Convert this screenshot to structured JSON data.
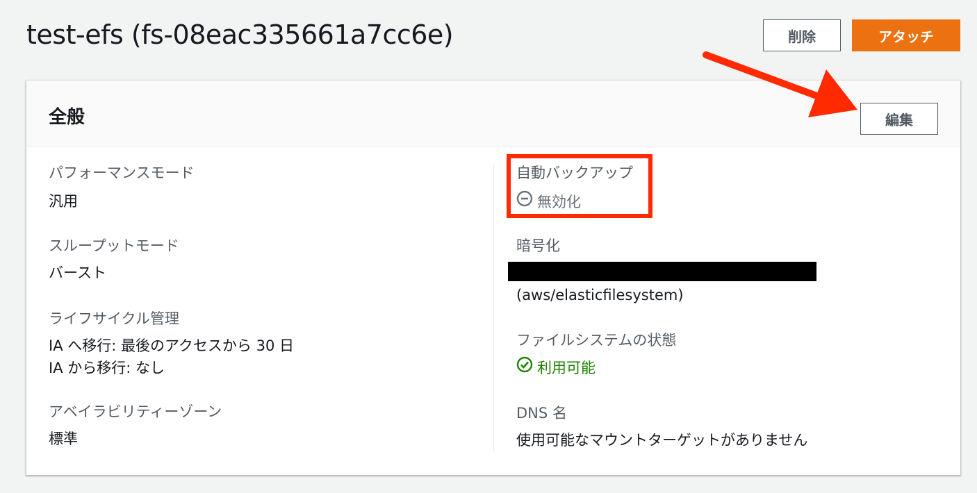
{
  "header": {
    "title": "test-efs (fs-08eac335661a7cc6e)",
    "delete_label": "削除",
    "attach_label": "アタッチ"
  },
  "panel": {
    "title": "全般",
    "edit_label": "編集"
  },
  "left_fields": {
    "performance_mode": {
      "label": "パフォーマンスモード",
      "value": "汎用"
    },
    "throughput_mode": {
      "label": "スループットモード",
      "value": "バースト"
    },
    "lifecycle": {
      "label": "ライフサイクル管理",
      "value_line1": "IA へ移行: 最後のアクセスから 30 日",
      "value_line2": "IA から移行: なし"
    },
    "availability_zone": {
      "label": "アベイラビリティーゾーン",
      "value": "標準"
    }
  },
  "right_fields": {
    "auto_backup": {
      "label": "自動バックアップ",
      "value": "無効化",
      "icon": "minus-circle-icon"
    },
    "encryption": {
      "label": "暗号化",
      "value": "(aws/elasticfilesystem)"
    },
    "fs_state": {
      "label": "ファイルシステムの状態",
      "value": "利用可能",
      "icon": "check-circle-icon"
    },
    "dns_name": {
      "label": "DNS 名",
      "value": "使用可能なマウントターゲットがありません"
    }
  },
  "colors": {
    "accent": "#ec7211",
    "success": "#1d8102",
    "annotation": "#ff2a00"
  }
}
